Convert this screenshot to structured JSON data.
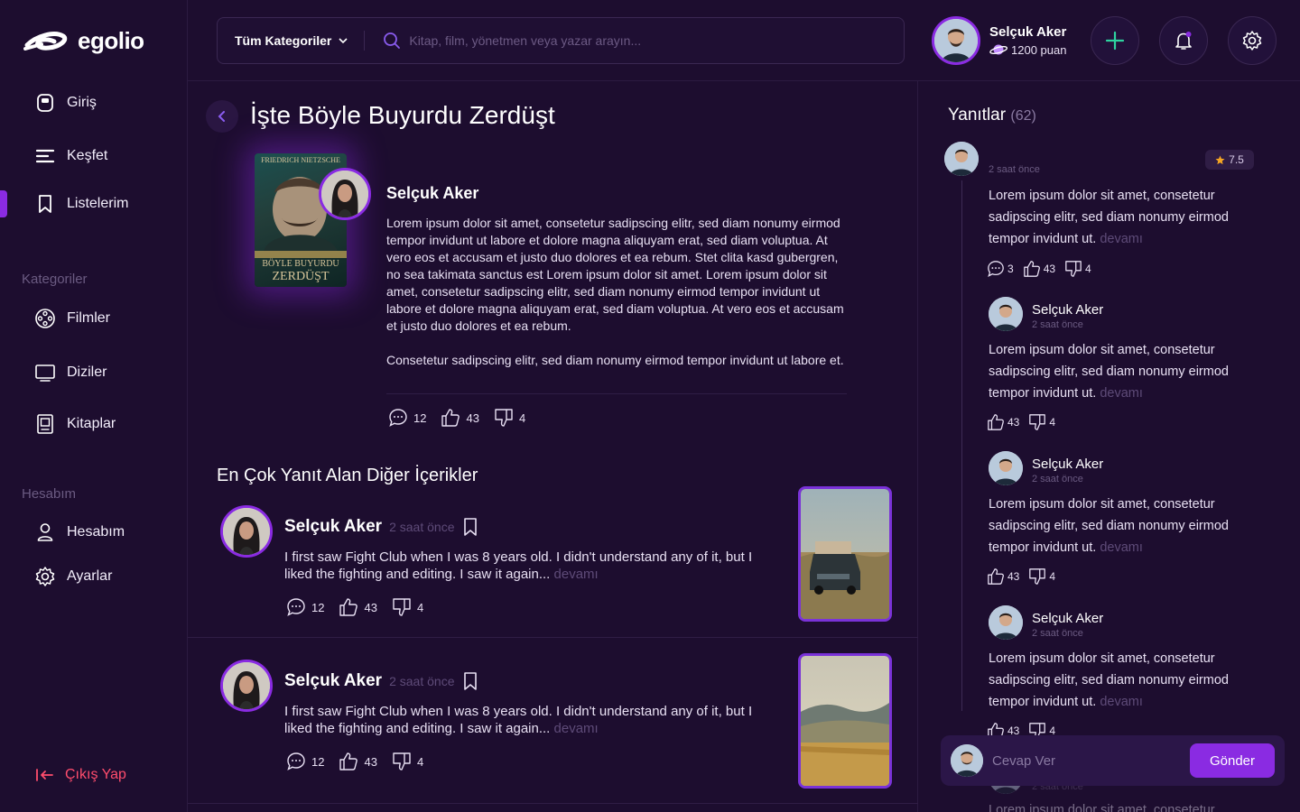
{
  "brand": {
    "name": "egolio"
  },
  "sidebar": {
    "items": [
      {
        "label": "Giriş",
        "icon": "home-icon"
      },
      {
        "label": "Keşfet",
        "icon": "explore-icon"
      },
      {
        "label": "Listelerim",
        "icon": "bookmark-icon"
      }
    ],
    "categories_title": "Kategoriler",
    "categories": [
      {
        "label": "Filmler",
        "icon": "film-reel-icon"
      },
      {
        "label": "Diziler",
        "icon": "tv-icon"
      },
      {
        "label": "Kitaplar",
        "icon": "book-icon"
      }
    ],
    "account_title": "Hesabım",
    "account": [
      {
        "label": "Hesabım",
        "icon": "user-icon"
      },
      {
        "label": "Ayarlar",
        "icon": "gear-icon"
      }
    ],
    "logout_label": "Çıkış Yap"
  },
  "topbar": {
    "category_select": "Tüm Kategoriler",
    "search_placeholder": "Kitap, film, yönetmen veya yazar arayın...",
    "user": {
      "name": "Selçuk Aker",
      "points": "1200 puan"
    }
  },
  "post": {
    "title": "İşte Böyle Buyurdu Zerdüşt",
    "book_cover": {
      "author_line": "FRIEDRICH NIETZSCHE",
      "title_line1": "BÖYLE BUYURDU",
      "title_line2": "ZERDÜŞT"
    },
    "author": "Selçuk Aker",
    "paragraphs": [
      "Lorem ipsum dolor sit amet, consetetur sadipscing elitr, sed diam nonumy eirmod tempor invidunt ut labore et dolore magna aliquyam erat, sed diam voluptua. At vero eos et accusam et justo duo dolores et ea rebum. Stet clita kasd gubergren, no sea takimata sanctus est Lorem ipsum dolor sit amet. Lorem ipsum dolor sit amet, consetetur sadipscing elitr, sed diam nonumy eirmod tempor invidunt ut labore et dolore magna aliquyam erat, sed diam voluptua. At vero eos et accusam et justo duo dolores et ea rebum.",
      "Consetetur sadipscing elitr, sed diam nonumy eirmod tempor invidunt ut labore et."
    ],
    "stats": {
      "comments": "12",
      "likes": "43",
      "dislikes": "4"
    }
  },
  "others": {
    "heading": "En Çok Yanıt Alan Diğer İçerikler",
    "items": [
      {
        "author": "Selçuk Aker",
        "time": "2 saat önce",
        "text": "I first saw Fight Club when I was 8 years old. I didn't understand any of it, but I liked the fighting and editing. I saw it again...",
        "more": "devamı",
        "comments": "12",
        "likes": "43",
        "dislikes": "4"
      },
      {
        "author": "Selçuk Aker",
        "time": "2 saat önce",
        "text": "I first saw Fight Club when I was 8 years old. I didn't understand any of it, but I liked the fighting and editing. I saw it again...",
        "more": "devamı",
        "comments": "12",
        "likes": "43",
        "dislikes": "4"
      }
    ]
  },
  "replies": {
    "title": "Yanıtlar",
    "count": "(62)",
    "main": {
      "time": "2 saat önce",
      "rating": "7.5",
      "text": "Lorem ipsum dolor sit amet, consetetur sadipscing elitr, sed diam nonumy eirmod tempor invidunt ut.",
      "more": "devamı",
      "comments": "3",
      "likes": "43",
      "dislikes": "4"
    },
    "items": [
      {
        "name": "Selçuk Aker",
        "time": "2 saat önce",
        "text": "Lorem ipsum dolor sit amet, consetetur sadipscing elitr, sed diam nonumy eirmod tempor invidunt ut.",
        "more": "devamı",
        "likes": "43",
        "dislikes": "4"
      },
      {
        "name": "Selçuk Aker",
        "time": "2 saat önce",
        "text": "Lorem ipsum dolor sit amet, consetetur sadipscing elitr, sed diam nonumy eirmod tempor invidunt ut.",
        "more": "devamı",
        "likes": "43",
        "dislikes": "4"
      },
      {
        "name": "Selçuk Aker",
        "time": "2 saat önce",
        "text": "Lorem ipsum dolor sit amet, consetetur sadipscing elitr, sed diam nonumy eirmod tempor invidunt ut.",
        "more": "devamı",
        "likes": "43",
        "dislikes": "4"
      }
    ],
    "partial": {
      "time": "2 saat önce",
      "text": "Lorem ipsum dolor sit amet, consetetur"
    },
    "composer": {
      "placeholder": "Cevap Ver",
      "send_label": "Gönder"
    }
  },
  "colors": {
    "background": "#1d0d2f",
    "accent": "#8a2be2",
    "logout": "#ff4d6d",
    "plus": "#2ed3a0",
    "rating_star": "#f5a623"
  }
}
